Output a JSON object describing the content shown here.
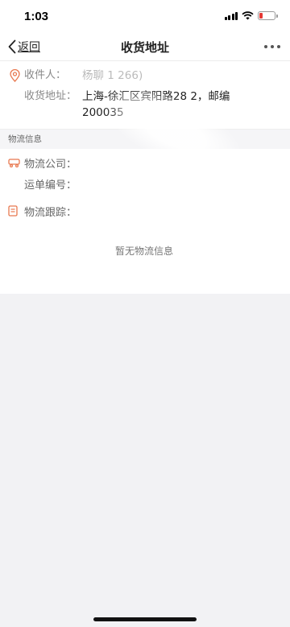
{
  "status": {
    "time": "1:03"
  },
  "nav": {
    "back_label": "返回",
    "title": "收货地址"
  },
  "address": {
    "recipient_label": "收件人：",
    "recipient_value": "杨聊    1        266)",
    "addr_label": "收货地址：",
    "addr_line1": "上海-徐汇区宾阳路28         2，邮编",
    "addr_line2": "200035"
  },
  "section": {
    "title": "物流信息"
  },
  "logistics": {
    "company_label": "物流公司：",
    "tracking_label": "运单编号：",
    "track_label": "物流跟踪：",
    "empty_text": "暂无物流信息"
  },
  "colors": {
    "accent": "#e8784f",
    "battery_low": "#e53935"
  },
  "icons": [
    "location-pin-icon",
    "truck-icon",
    "document-icon",
    "back-chevron-icon",
    "more-dots-icon",
    "signal-icon",
    "wifi-icon",
    "battery-icon"
  ]
}
